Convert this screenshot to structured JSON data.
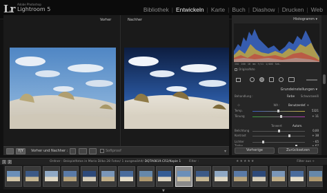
{
  "logo": {
    "mark": "Lr",
    "small": "Adobe Photoshop",
    "name": "Lightroom 5"
  },
  "modules": [
    {
      "label": "Bibliothek",
      "active": false
    },
    {
      "label": "Entwickeln",
      "active": true
    },
    {
      "label": "Karte",
      "active": false
    },
    {
      "label": "Buch",
      "active": false
    },
    {
      "label": "Diashow",
      "active": false
    },
    {
      "label": "Drucken",
      "active": false
    },
    {
      "label": "Web",
      "active": false
    }
  ],
  "compare": {
    "before": "Vorher",
    "after": "Nachher"
  },
  "toolbar": {
    "yy": "Y|Y",
    "mode": "Vorher und Nachher :",
    "softproof": "Softproof",
    "arrow": "▾"
  },
  "right": {
    "histogram_title": "Histogramm ▾",
    "hist_info": "ISO 200    16 mm    f/11    1/400 Sek.",
    "orig_label": "Originalfoto",
    "grund_title": "Grundeinstellungen ▾",
    "behandlung": "Behandlung :",
    "farbe": "Farbe",
    "sw": "Schwarzweiß",
    "wb_label": "WA :",
    "wb_value": "Benutzerdef. ÷",
    "temp": {
      "label": "Temp.",
      "value": "5321"
    },
    "tonung": {
      "label": "Tönung",
      "value": "+ 11"
    },
    "ton_label": "Tonwert",
    "auto_label": "Autom.",
    "belichtung": {
      "label": "Belichtung",
      "value": "0,00"
    },
    "kontrast": {
      "label": "Kontrast",
      "value": "+ 38"
    },
    "lichter": {
      "label": "Lichter",
      "value": "– 65"
    },
    "tiefen": {
      "label": "Tiefen",
      "value": "+ 67"
    },
    "weiss": {
      "label": "Weiß",
      "value": "+ 13"
    },
    "schwarz": {
      "label": "Schwarz",
      "value": "– 5"
    },
    "btn_prev": "Vorherige",
    "btn_reset": "Zurücksetzen"
  },
  "filmstrip_bar": {
    "nums": [
      "1",
      "2"
    ],
    "path": "Ordner : Beispielfotos in Mario Dilko",
    "count": "28 Fotos/ 1 ausgewählt/",
    "file": "DQTA0819.CR2/Kopie 1",
    "filter": "Filter :",
    "stars": "★★★★★",
    "filter_off": "Filter aus ÷"
  },
  "thumb_count": 17,
  "selected_thumb": 9,
  "colors": {
    "accent": "#eeeeee",
    "panel": "#262626",
    "bg": "#111111"
  },
  "bottom_arrow": "▼"
}
